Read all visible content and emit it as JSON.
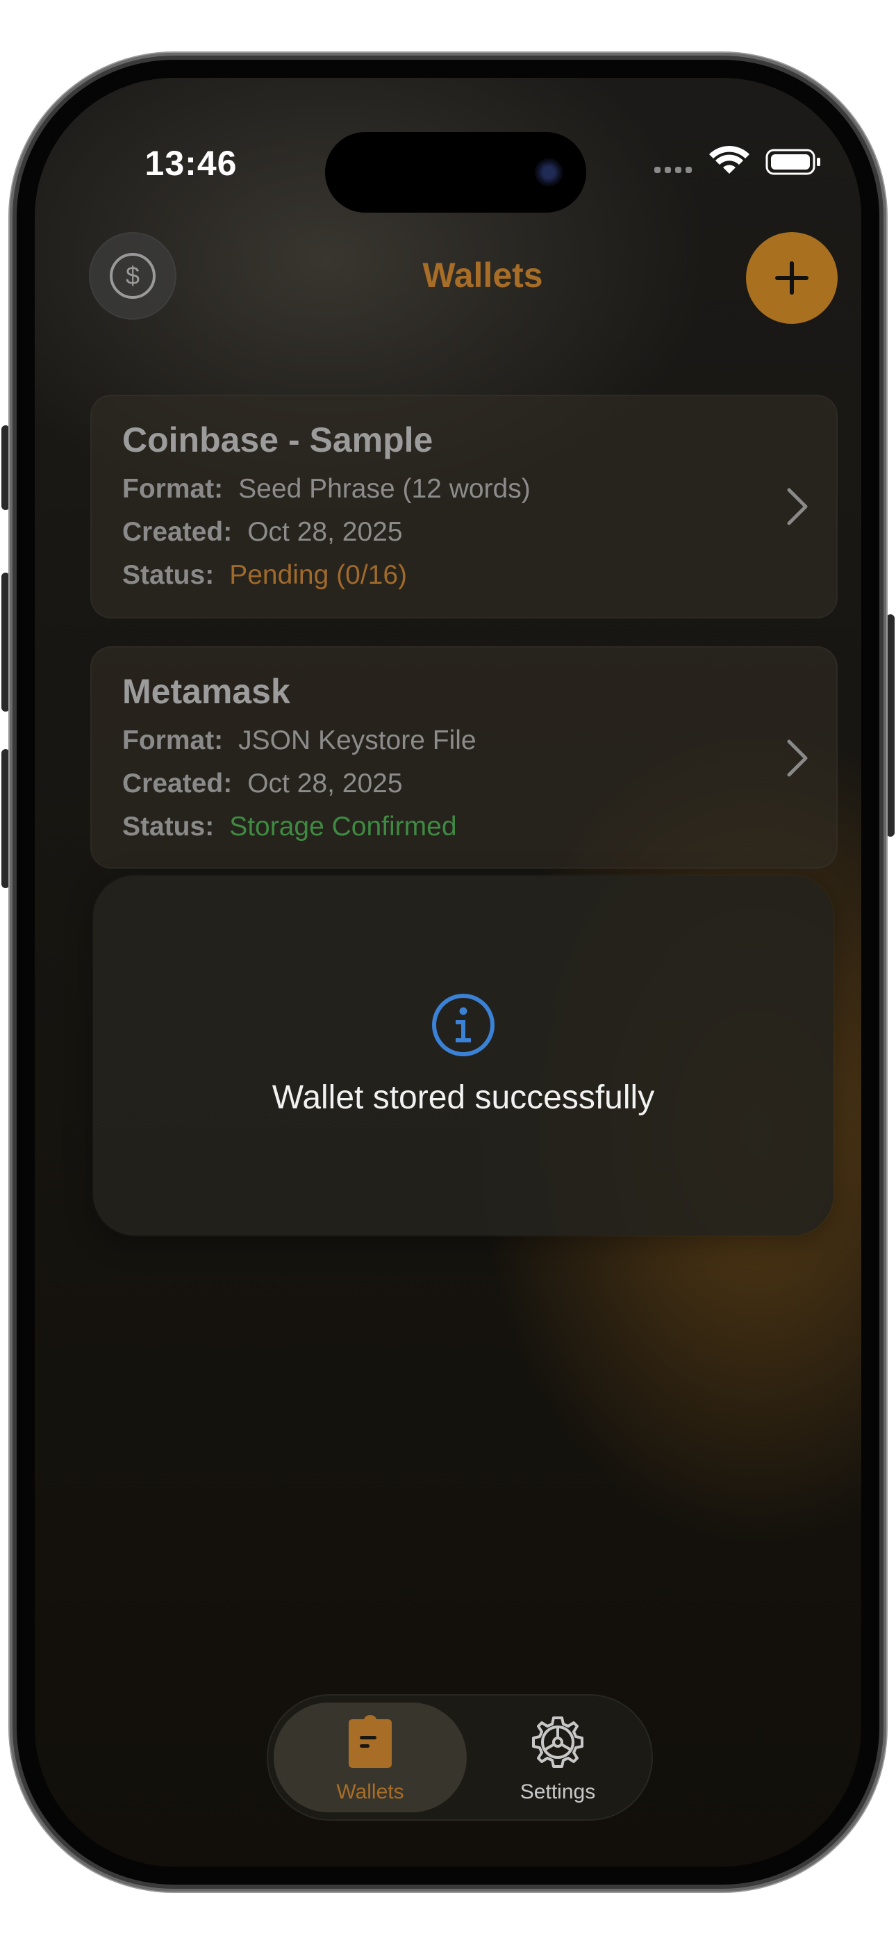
{
  "status_bar": {
    "time": "13:46"
  },
  "nav": {
    "title": "Wallets",
    "left_icon": "dollar-circle-icon",
    "right_icon": "plus-icon"
  },
  "wallets": [
    {
      "name": "Coinbase - Sample",
      "format_label": "Format:",
      "format": "Seed Phrase (12 words)",
      "created_label": "Created:",
      "created": "Oct 28, 2025",
      "status_label": "Status:",
      "status": "Pending (0/16)",
      "status_color": "#a06a2b"
    },
    {
      "name": "Metamask",
      "format_label": "Format:",
      "format": "JSON Keystore File",
      "created_label": "Created:",
      "created": "Oct 28, 2025",
      "status_label": "Status:",
      "status": "Storage Confirmed",
      "status_color": "#3f8a43"
    }
  ],
  "toast": {
    "icon": "info-circle-icon",
    "message": "Wallet stored successfully",
    "icon_color": "#3b82d6"
  },
  "tabbar": {
    "tabs": [
      {
        "label": "Wallets",
        "icon": "wallet-icon",
        "active": true,
        "color": "#a86d26"
      },
      {
        "label": "Settings",
        "icon": "gear-icon",
        "active": false,
        "color": "#c8c8c8"
      }
    ]
  },
  "colors": {
    "accent": "#a86d26",
    "background": "#16140f"
  }
}
